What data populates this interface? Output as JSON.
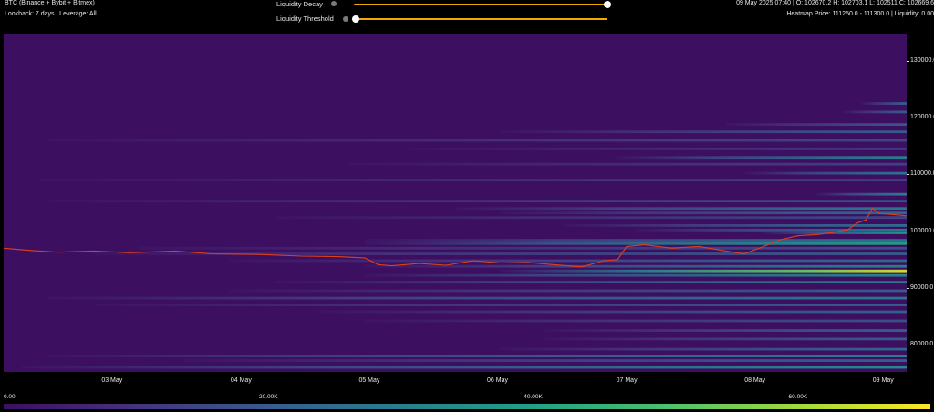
{
  "header": {
    "title": "BTC (Binance + Bybit + Bitmex)",
    "subtitle": "Lookback: 7 days | Leverage: All",
    "ohlc": "09 May 2025 07:40 | O: 102670.2 H: 102703.1 L: 102511 C: 102669.6",
    "heatmap_info": "Heatmap Price: 111250.0 - 111300.0 | Liquidity: 0.00"
  },
  "controls": {
    "decay_label": "Liquidity Decay",
    "decay_value": 1.0,
    "threshold_label": "Liquidity Threshold",
    "threshold_value": 0.0
  },
  "colors": {
    "background": "#000000",
    "slider_track": "#f2a900",
    "price_line": "#e0401a",
    "colormap": [
      "#3d0f61",
      "#46327e",
      "#365c8d",
      "#277f8e",
      "#1fa187",
      "#4ac16d",
      "#a0da39",
      "#fde725"
    ]
  },
  "chart_data": {
    "type": "heatmap",
    "title": "BTC (Binance + Bybit + Bitmex)",
    "xlabel": "",
    "ylabel": "",
    "x_ticks": [
      "03 May",
      "04 May",
      "05 May",
      "06 May",
      "07 May",
      "08 May",
      "09 May"
    ],
    "y_ticks": [
      80000,
      90000,
      100000,
      110000,
      120000,
      130000
    ],
    "y_tick_labels": [
      "80000.0",
      "90000.0",
      "100000.0",
      "110000.0",
      "120000.0",
      "130000.0"
    ],
    "xlim": [
      "02 May 2025 02:00",
      "09 May 2025 07:40"
    ],
    "ylim": [
      75200,
      134800
    ],
    "colorbar": {
      "range": [
        0,
        70000
      ],
      "ticks": [
        0,
        20000,
        40000,
        60000
      ],
      "tick_labels": [
        "0.00",
        "20.00K",
        "40.00K",
        "60.00K"
      ]
    },
    "liquidity_bands": [
      {
        "price": 116000,
        "start": 0.05,
        "max": 0.22
      },
      {
        "price": 117500,
        "start": 0.55,
        "max": 0.3
      },
      {
        "price": 118800,
        "start": 0.8,
        "max": 0.28
      },
      {
        "price": 121000,
        "start": 0.93,
        "max": 0.3
      },
      {
        "price": 122500,
        "start": 0.95,
        "max": 0.32
      },
      {
        "price": 114500,
        "start": 0.45,
        "max": 0.18
      },
      {
        "price": 113000,
        "start": 0.68,
        "max": 0.45
      },
      {
        "price": 111800,
        "start": 0.38,
        "max": 0.2
      },
      {
        "price": 110200,
        "start": 0.82,
        "max": 0.4
      },
      {
        "price": 109000,
        "start": 0.04,
        "max": 0.2
      },
      {
        "price": 106500,
        "start": 0.9,
        "max": 0.45
      },
      {
        "price": 105300,
        "start": 0.05,
        "max": 0.25
      },
      {
        "price": 104000,
        "start": 0.5,
        "max": 0.42
      },
      {
        "price": 103200,
        "start": 0.55,
        "max": 0.35
      },
      {
        "price": 102400,
        "start": 0.3,
        "max": 0.22
      },
      {
        "price": 101000,
        "start": 0.62,
        "max": 0.38
      },
      {
        "price": 100200,
        "start": 0.7,
        "max": 0.42
      },
      {
        "price": 99700,
        "start": 0.84,
        "max": 0.55
      },
      {
        "price": 98400,
        "start": 0.4,
        "max": 0.4
      },
      {
        "price": 97800,
        "start": 0.4,
        "max": 0.58
      },
      {
        "price": 97000,
        "start": 0.15,
        "max": 0.25
      },
      {
        "price": 96000,
        "start": 0.1,
        "max": 0.3
      },
      {
        "price": 94800,
        "start": 0.25,
        "max": 0.35
      },
      {
        "price": 93800,
        "start": 0.4,
        "max": 0.45
      },
      {
        "price": 93000,
        "start": 0.55,
        "max": 0.95
      },
      {
        "price": 92200,
        "start": 0.4,
        "max": 0.48
      },
      {
        "price": 91000,
        "start": 0.3,
        "max": 0.42
      },
      {
        "price": 89500,
        "start": 0.25,
        "max": 0.3
      },
      {
        "price": 88200,
        "start": 0.05,
        "max": 0.42
      },
      {
        "price": 87000,
        "start": 0.1,
        "max": 0.3
      },
      {
        "price": 85800,
        "start": 0.35,
        "max": 0.32
      },
      {
        "price": 84200,
        "start": 0.4,
        "max": 0.26
      },
      {
        "price": 82500,
        "start": 0.6,
        "max": 0.32
      },
      {
        "price": 81000,
        "start": 0.6,
        "max": 0.3
      },
      {
        "price": 79200,
        "start": 0.55,
        "max": 0.34
      },
      {
        "price": 78000,
        "start": 0.05,
        "max": 0.45
      },
      {
        "price": 77200,
        "start": 0.2,
        "max": 0.32
      },
      {
        "price": 76000,
        "start": 0.02,
        "max": 0.5
      }
    ],
    "price_series": {
      "name": "BTC price",
      "points": [
        [
          0.0,
          97000
        ],
        [
          0.03,
          96600
        ],
        [
          0.06,
          96300
        ],
        [
          0.1,
          96500
        ],
        [
          0.14,
          96200
        ],
        [
          0.19,
          96500
        ],
        [
          0.23,
          96000
        ],
        [
          0.28,
          95900
        ],
        [
          0.33,
          95600
        ],
        [
          0.37,
          95500
        ],
        [
          0.4,
          95300
        ],
        [
          0.415,
          94100
        ],
        [
          0.43,
          93900
        ],
        [
          0.46,
          94300
        ],
        [
          0.49,
          94000
        ],
        [
          0.52,
          94800
        ],
        [
          0.55,
          94400
        ],
        [
          0.58,
          94500
        ],
        [
          0.61,
          94100
        ],
        [
          0.64,
          93700
        ],
        [
          0.665,
          94800
        ],
        [
          0.68,
          95000
        ],
        [
          0.69,
          97300
        ],
        [
          0.71,
          97600
        ],
        [
          0.74,
          97000
        ],
        [
          0.77,
          97300
        ],
        [
          0.8,
          96500
        ],
        [
          0.82,
          96000
        ],
        [
          0.84,
          97200
        ],
        [
          0.86,
          98500
        ],
        [
          0.88,
          99200
        ],
        [
          0.9,
          99400
        ],
        [
          0.92,
          99800
        ],
        [
          0.935,
          100300
        ],
        [
          0.945,
          101400
        ],
        [
          0.955,
          102000
        ],
        [
          0.962,
          104000
        ],
        [
          0.97,
          103100
        ],
        [
          0.98,
          103000
        ],
        [
          1.0,
          102700
        ]
      ]
    }
  }
}
